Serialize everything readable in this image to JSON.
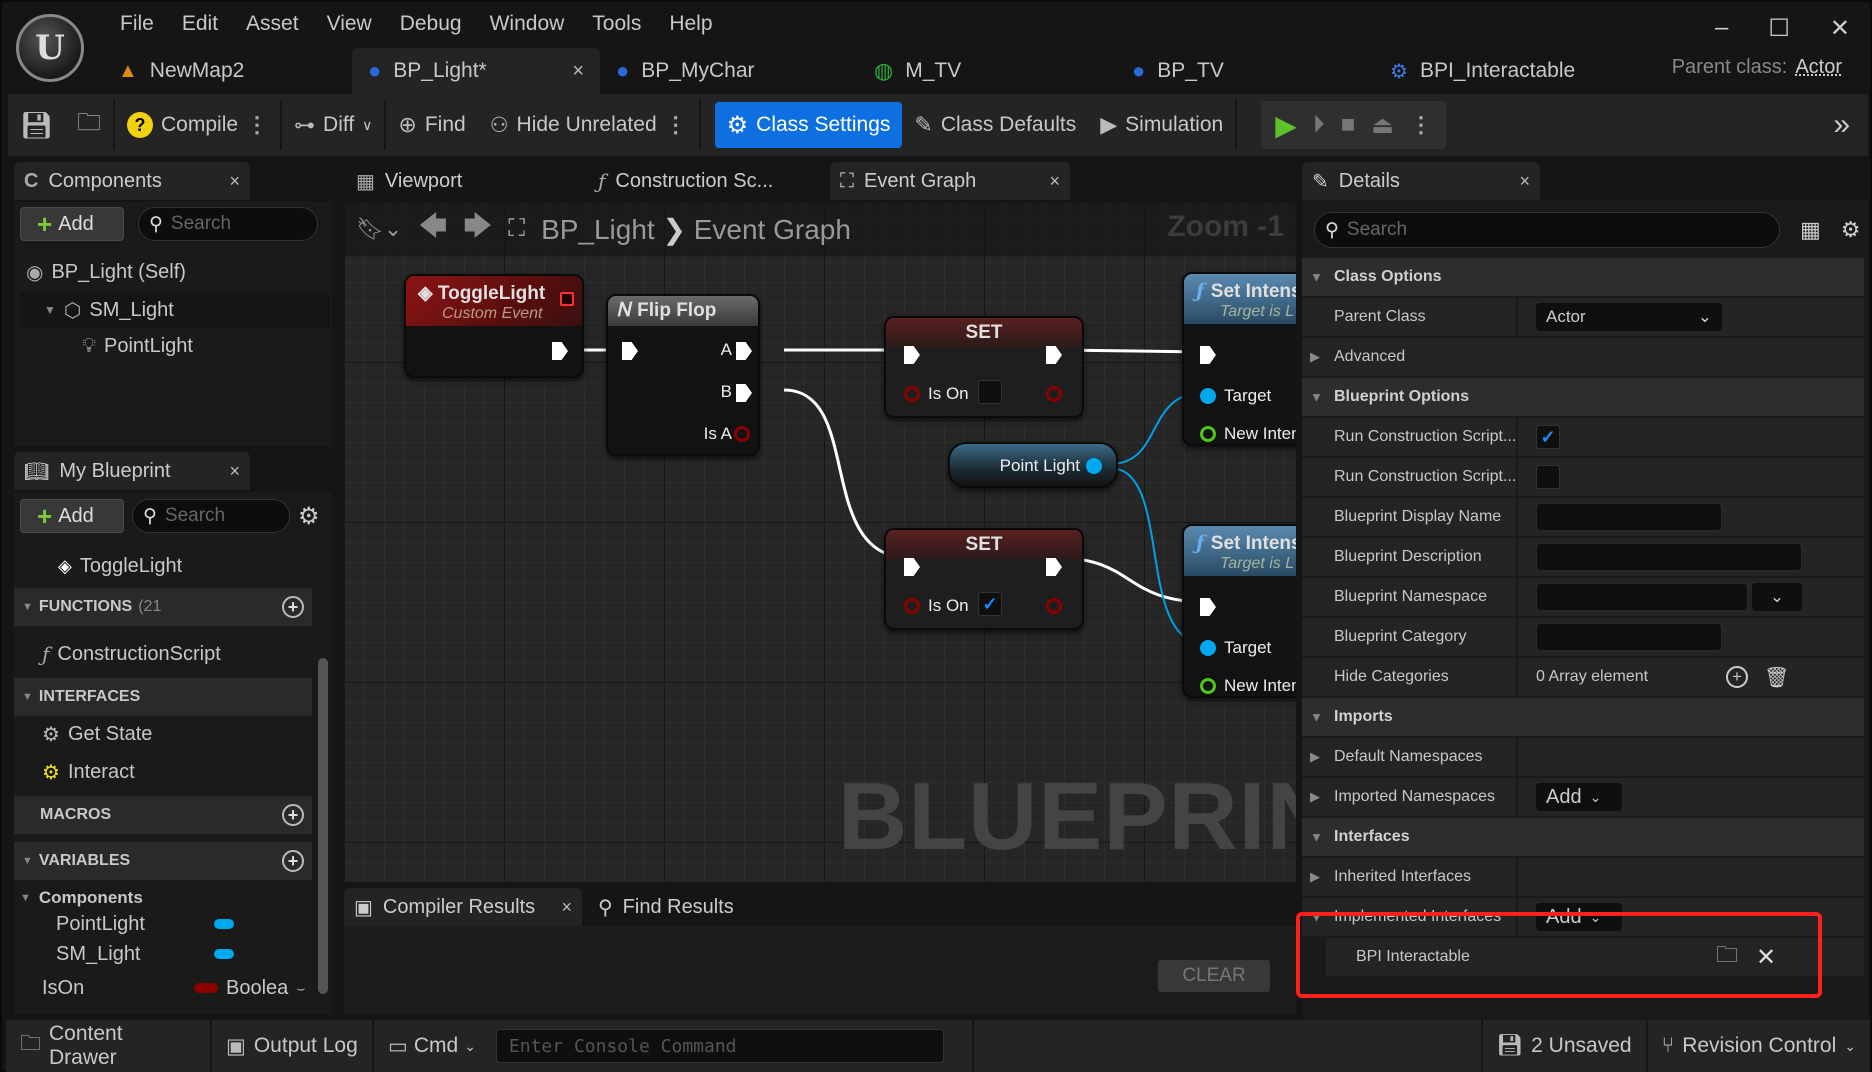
{
  "app": {
    "menu": [
      "File",
      "Edit",
      "Asset",
      "View",
      "Debug",
      "Window",
      "Tools",
      "Help"
    ],
    "window_controls": {
      "minimize": "–",
      "maximize": "☐",
      "close": "✕"
    }
  },
  "doc_tabs": [
    {
      "label": "NewMap2",
      "icon": "level-icon",
      "active": false
    },
    {
      "label": "BP_Light*",
      "icon": "blueprint-actor-icon",
      "active": true,
      "close": "×"
    },
    {
      "label": "BP_MyChar",
      "icon": "character-icon",
      "active": false
    },
    {
      "label": "M_TV",
      "icon": "material-icon",
      "active": false
    },
    {
      "label": "BP_TV",
      "icon": "blueprint-actor-icon",
      "active": false
    },
    {
      "label": "BPI_Interactable",
      "icon": "interface-icon",
      "active": false
    }
  ],
  "parent_class": {
    "label": "Parent class:",
    "value": "Actor"
  },
  "toolbar": {
    "compile": "Compile",
    "diff": "Diff",
    "find": "Find",
    "hide_unrelated": "Hide Unrelated",
    "class_settings": "Class Settings",
    "class_defaults": "Class Defaults",
    "simulation": "Simulation"
  },
  "components_panel": {
    "title": "Components",
    "add": "Add",
    "search_placeholder": "Search",
    "tree": [
      {
        "label": "BP_Light (Self)",
        "icon": "actor-icon",
        "depth": 0
      },
      {
        "label": "SM_Light",
        "icon": "static-mesh-icon",
        "depth": 1,
        "expanded": true
      },
      {
        "label": "PointLight",
        "icon": "light-bulb-icon",
        "depth": 2
      }
    ]
  },
  "my_blueprint": {
    "title": "My Blueprint",
    "add": "Add",
    "search_placeholder": "Search",
    "events": [
      "ToggleLight"
    ],
    "sections": {
      "functions": {
        "label": "FUNCTIONS",
        "count": "(21",
        "items": [
          "ConstructionScript"
        ]
      },
      "interfaces": {
        "label": "INTERFACES",
        "items": [
          "Get State",
          "Interact"
        ]
      },
      "macros": {
        "label": "MACROS"
      },
      "variables": {
        "label": "VARIABLES"
      }
    },
    "variable_groups": {
      "components": "Components"
    },
    "variables": [
      {
        "name": "PointLight",
        "type": "",
        "color": "#00a8f0"
      },
      {
        "name": "SM_Light",
        "type": "",
        "color": "#00a8f0"
      },
      {
        "name": "IsOn",
        "type": "Boolea",
        "color": "#8c0000"
      }
    ]
  },
  "editor_tabs": [
    {
      "label": "Viewport"
    },
    {
      "label": "Construction Sc..."
    },
    {
      "label": "Event Graph",
      "active": true,
      "close": "×"
    }
  ],
  "graph": {
    "breadcrumb": [
      "BP_Light",
      "Event Graph"
    ],
    "zoom": "Zoom -1",
    "watermark": "BLUEPRINT",
    "nodes": {
      "toggle": {
        "title": "ToggleLight",
        "subtitle": "Custom Event"
      },
      "flipflop": {
        "title": "Flip Flop",
        "pins": [
          "A",
          "B",
          "Is A"
        ]
      },
      "set1": {
        "title": "SET",
        "pin": "Is On",
        "checked": false
      },
      "set2": {
        "title": "SET",
        "pin": "Is On",
        "checked": true
      },
      "pointlight": {
        "label": "Point Light"
      },
      "setint1": {
        "title": "Set Intens",
        "subtitle": "Target is L",
        "pins": [
          "Target",
          "New Inten"
        ]
      },
      "setint2": {
        "title": "Set Intens",
        "subtitle": "Target is L",
        "pins": [
          "Target",
          "New Inten"
        ]
      }
    }
  },
  "bottom_tabs": {
    "compiler": "Compiler Results",
    "find": "Find Results",
    "clear": "CLEAR"
  },
  "details": {
    "title": "Details",
    "search_placeholder": "Search",
    "rows": [
      {
        "type": "header",
        "label": "Class Options"
      },
      {
        "type": "prop",
        "label": "Parent Class",
        "value": "Actor",
        "control": "dropdown"
      },
      {
        "type": "collapsed",
        "label": "Advanced"
      },
      {
        "type": "header",
        "label": "Blueprint Options"
      },
      {
        "type": "prop",
        "label": "Run Construction Script...",
        "control": "checkbox",
        "checked": true
      },
      {
        "type": "prop",
        "label": "Run Construction Script...",
        "control": "checkbox",
        "checked": false
      },
      {
        "type": "prop",
        "label": "Blueprint Display Name",
        "control": "text",
        "value": ""
      },
      {
        "type": "prop",
        "label": "Blueprint Description",
        "control": "text-wide",
        "value": ""
      },
      {
        "type": "prop",
        "label": "Blueprint Namespace",
        "control": "combo",
        "value": ""
      },
      {
        "type": "prop",
        "label": "Blueprint Category",
        "control": "text",
        "value": ""
      },
      {
        "type": "prop",
        "label": "Hide Categories",
        "control": "array",
        "value": "0 Array element"
      },
      {
        "type": "header",
        "label": "Imports"
      },
      {
        "type": "collapsed",
        "label": "Default Namespaces"
      },
      {
        "type": "collapsed",
        "label": "Imported Namespaces",
        "control": "add",
        "value": "Add"
      },
      {
        "type": "header",
        "label": "Interfaces"
      },
      {
        "type": "collapsed",
        "label": "Inherited Interfaces"
      },
      {
        "type": "expanded",
        "label": "Implemented Interfaces",
        "control": "add",
        "value": "Add"
      },
      {
        "type": "child",
        "label": "BPI Interactable"
      }
    ]
  },
  "status_bar": {
    "content_drawer": "Content Drawer",
    "output_log": "Output Log",
    "cmd": "Cmd",
    "console_placeholder": "Enter Console Command",
    "unsaved": "2 Unsaved",
    "revision": "Revision Control"
  },
  "highlight_color": "#ff1f1f",
  "accent_color": "#0e70e0"
}
